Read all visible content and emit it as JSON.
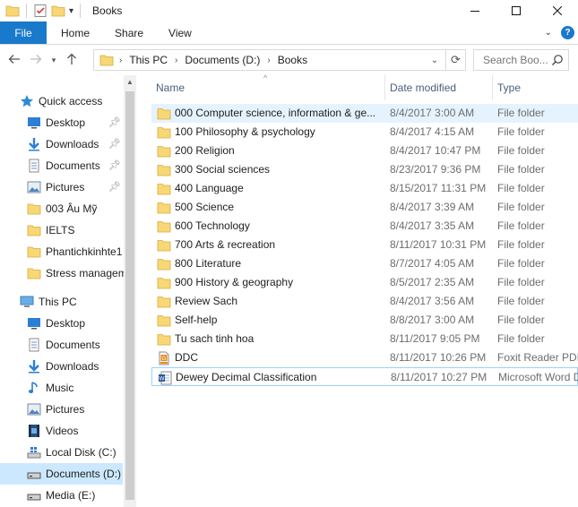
{
  "window": {
    "title": "Books",
    "minimize_icon": "minimize-icon",
    "maximize_icon": "maximize-icon",
    "close_icon": "close-icon"
  },
  "ribbon": {
    "tabs": [
      {
        "label": "File"
      },
      {
        "label": "Home"
      },
      {
        "label": "Share"
      },
      {
        "label": "View"
      }
    ],
    "help_label": "?"
  },
  "address": {
    "crumbs": [
      "This PC",
      "Documents (D:)",
      "Books"
    ],
    "search_placeholder": "Search Boo..."
  },
  "nav_pane": {
    "quick_access": {
      "label": "Quick access"
    },
    "quick_items": [
      {
        "label": "Desktop",
        "icon": "desktop-icon",
        "pinned": true
      },
      {
        "label": "Downloads",
        "icon": "downloads-icon",
        "pinned": true
      },
      {
        "label": "Documents",
        "icon": "documents-icon",
        "pinned": true
      },
      {
        "label": "Pictures",
        "icon": "pictures-icon",
        "pinned": true
      },
      {
        "label": "003 Âu Mỹ",
        "icon": "folder-icon",
        "pinned": false
      },
      {
        "label": "IELTS",
        "icon": "folder-icon",
        "pinned": false
      },
      {
        "label": "Phantichkinhte1",
        "icon": "folder-icon",
        "pinned": false
      },
      {
        "label": "Stress managem",
        "icon": "folder-icon",
        "pinned": false
      }
    ],
    "this_pc": {
      "label": "This PC"
    },
    "pc_items": [
      {
        "label": "Desktop",
        "icon": "desktop-icon"
      },
      {
        "label": "Documents",
        "icon": "documents-icon"
      },
      {
        "label": "Downloads",
        "icon": "downloads-icon"
      },
      {
        "label": "Music",
        "icon": "music-icon"
      },
      {
        "label": "Pictures",
        "icon": "pictures-icon"
      },
      {
        "label": "Videos",
        "icon": "videos-icon"
      },
      {
        "label": "Local Disk (C:)",
        "icon": "windows-drive-icon"
      },
      {
        "label": "Documents (D:)",
        "icon": "drive-icon",
        "selected": true
      },
      {
        "label": "Media (E:)",
        "icon": "drive-icon"
      }
    ]
  },
  "columns": {
    "name": "Name",
    "date": "Date modified",
    "type": "Type"
  },
  "files": [
    {
      "name": "000 Computer science, information & ge...",
      "date": "8/4/2017 3:00 AM",
      "type": "File folder",
      "icon": "folder-icon",
      "selected": true
    },
    {
      "name": "100 Philosophy & psychology",
      "date": "8/4/2017 4:15 AM",
      "type": "File folder",
      "icon": "folder-icon"
    },
    {
      "name": "200 Religion",
      "date": "8/4/2017 10:47 PM",
      "type": "File folder",
      "icon": "folder-icon"
    },
    {
      "name": "300 Social sciences",
      "date": "8/23/2017 9:36 PM",
      "type": "File folder",
      "icon": "folder-icon"
    },
    {
      "name": "400 Language",
      "date": "8/15/2017 11:31 PM",
      "type": "File folder",
      "icon": "folder-icon"
    },
    {
      "name": "500 Science",
      "date": "8/4/2017 3:39 AM",
      "type": "File folder",
      "icon": "folder-icon"
    },
    {
      "name": "600 Technology",
      "date": "8/4/2017 3:35 AM",
      "type": "File folder",
      "icon": "folder-icon"
    },
    {
      "name": "700 Arts & recreation",
      "date": "8/11/2017 10:31 PM",
      "type": "File folder",
      "icon": "folder-icon"
    },
    {
      "name": "800 Literature",
      "date": "8/7/2017 4:05 AM",
      "type": "File folder",
      "icon": "folder-icon"
    },
    {
      "name": "900 History & geography",
      "date": "8/5/2017 2:35 AM",
      "type": "File folder",
      "icon": "folder-icon"
    },
    {
      "name": "Review Sach",
      "date": "8/4/2017 3:56 AM",
      "type": "File folder",
      "icon": "folder-icon"
    },
    {
      "name": "Self-help",
      "date": "8/8/2017 3:00 AM",
      "type": "File folder",
      "icon": "folder-icon"
    },
    {
      "name": "Tu sach tinh hoa",
      "date": "8/11/2017 9:05 PM",
      "type": "File folder",
      "icon": "folder-icon"
    },
    {
      "name": "DDC",
      "date": "8/11/2017 10:26 PM",
      "type": "Foxit Reader PDF ...",
      "icon": "pdf-icon"
    },
    {
      "name": "Dewey Decimal Classification",
      "date": "8/11/2017 10:27 PM",
      "type": "Microsoft Word D...",
      "icon": "word-doc-icon",
      "focused": true
    }
  ],
  "colors": {
    "accent": "#1979ca",
    "folder": "#f8d775",
    "selection": "#cce8ff",
    "hover_row": "#e5f3ff"
  }
}
